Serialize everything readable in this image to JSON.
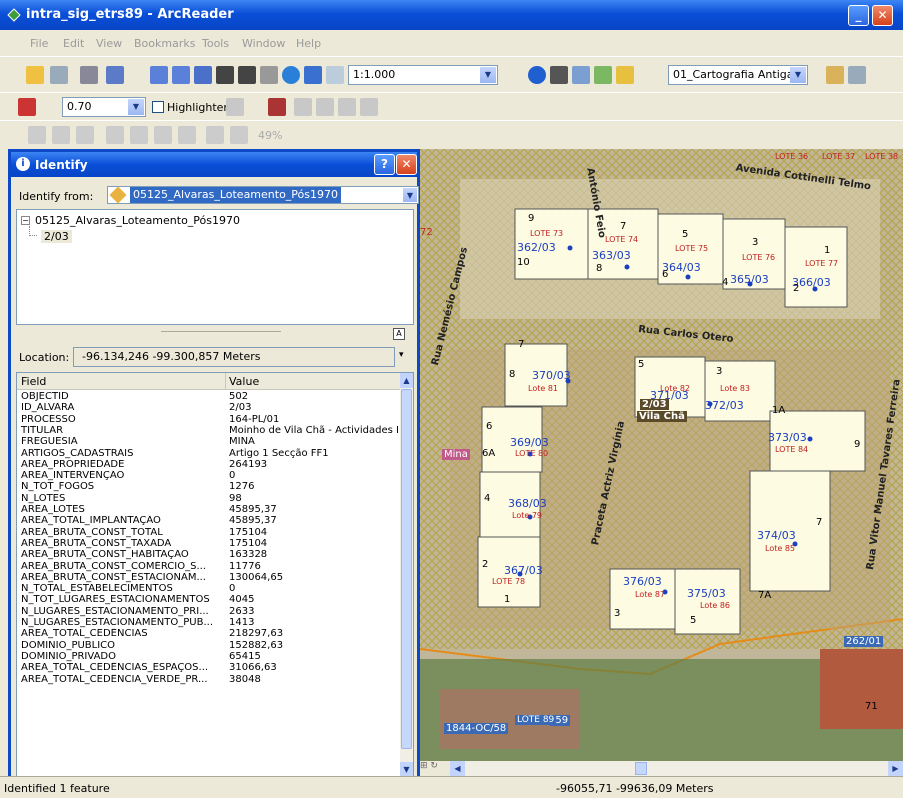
{
  "window": {
    "title": "intra_sig_etrs89 - ArcReader",
    "minimize": "_",
    "maximize": "□",
    "close": "✕"
  },
  "menu": [
    "File",
    "Edit",
    "View",
    "Bookmarks",
    "Tools",
    "Window",
    "Help"
  ],
  "toolbar": {
    "scale": "1:1.000",
    "layer": "01_Cartografia Antiga",
    "line_width": "0.70",
    "highlighter_label": "Highlighter",
    "zoom_pct": "49%"
  },
  "identify": {
    "title": "Identify",
    "help": "?",
    "close": "✕",
    "identify_from_label": "Identify from:",
    "identify_from_value": "05125_Alvaras_Loteamento_Pós1970",
    "tree_root": "05125_Alvaras_Loteamento_Pós1970",
    "tree_child": "2/03",
    "location_label": "Location:",
    "location_value": "-96.134,246  -99.300,857 Meters",
    "col_field": "Field",
    "col_value": "Value"
  },
  "attributes": [
    [
      "OBJECTID",
      "502"
    ],
    [
      "ID_ALVARA",
      "2/03"
    ],
    [
      "PROCESSO",
      "164-PL/01"
    ],
    [
      "TITULAR",
      "Moinho de Vila Chã - Actividades Im"
    ],
    [
      "FREGUESIA",
      "MINA"
    ],
    [
      "ARTIGOS_CADASTRAIS",
      "Artigo 1 Secção FF1"
    ],
    [
      "AREA_PROPRIEDADE",
      "264193"
    ],
    [
      "AREA_INTERVENÇÃO",
      "0"
    ],
    [
      "N_TOT_FOGOS",
      "1276"
    ],
    [
      "N_LOTES",
      "98"
    ],
    [
      "AREA_LOTES",
      "45895,37"
    ],
    [
      "AREA_TOTAL_IMPLANTAÇÃO",
      "45895,37"
    ],
    [
      "AREA_BRUTA_CONST_TOTAL",
      "175104"
    ],
    [
      "AREA_BRUTA_CONST_TAXADA",
      "175104"
    ],
    [
      "AREA_BRUTA_CONST_HABITAÇÃO",
      "163328"
    ],
    [
      "AREA_BRUTA_CONST_COMÉRCIO_S...",
      "11776"
    ],
    [
      "AREA_BRUTA_CONST_ESTACIONAM...",
      "130064,65"
    ],
    [
      "N_TOTAL_ESTABELECIMENTOS",
      "0"
    ],
    [
      "N_TOT_LUGARES_ESTACIONAMENTOS",
      "4045"
    ],
    [
      "N_LUGARES_ESTACIONAMENTO_PRI...",
      "2633"
    ],
    [
      "N_LUGARES_ESTACIONAMENTO_PUB...",
      "1413"
    ],
    [
      "AREA_TOTAL_CEDÊNCIAS",
      "218297,63"
    ],
    [
      "DOMINIO_PUBLICO",
      "152882,63"
    ],
    [
      "DOMINIO_PRIVADO",
      "65415"
    ],
    [
      "AREA_TOTAL_CEDÊNCIAS_ESPAÇOS...",
      "31066,63"
    ],
    [
      "AREA_TOTAL_CEDÊNCIA_VERDE_PR...",
      "38048"
    ]
  ],
  "map": {
    "streets": [
      "Avenida Cottinelli Telmo",
      "Rua Carlos Otero",
      "Rua Nemésio Campos",
      "Praceta Actriz Virgínia",
      "Rua Vitor Manuel Tavares Ferreira",
      "António Feio"
    ],
    "place": "Vila Chã",
    "place_code": "2/03",
    "parish": "Mina",
    "parcels": [
      "362/03",
      "363/03",
      "364/03",
      "365/03",
      "366/03",
      "370/03",
      "371/03",
      "372/03",
      "369/03",
      "373/03",
      "368/03",
      "374/03",
      "367/03",
      "376/03",
      "375/03",
      "262/01",
      "1844-OC/58",
      "/59"
    ],
    "lots": [
      "LOTE 73",
      "LOTE 74",
      "LOTE 75",
      "LOTE 76",
      "LOTE 77",
      "Lote 81",
      "Lote 82",
      "Lote 83",
      "LOTE 80",
      "LOTE 84",
      "Lote 79",
      "Lote 85",
      "LOTE 78",
      "Lote 87",
      "Lote 86",
      "LOTE 36",
      "LOTE 37",
      "LOTE 38",
      "LOTE 89"
    ],
    "numbers": [
      "9",
      "7",
      "5",
      "3",
      "1",
      "10",
      "8",
      "6",
      "4",
      "2",
      "7",
      "5",
      "3",
      "1A",
      "8",
      "6",
      "6A",
      "9",
      "4",
      "7",
      "2",
      "1",
      "3",
      "5",
      "7A",
      "72",
      "71"
    ]
  },
  "status": {
    "left": "Identified 1 feature",
    "coords": "-96055,71  -99636,09 Meters"
  }
}
